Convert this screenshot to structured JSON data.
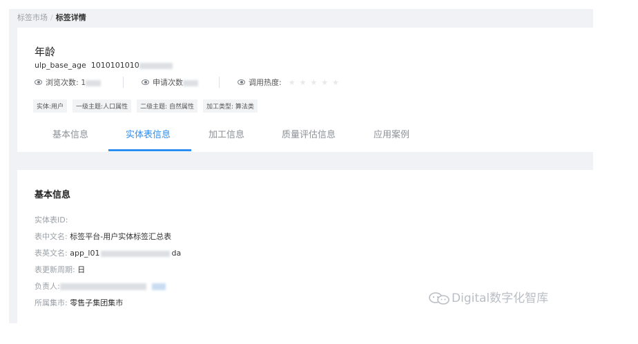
{
  "breadcrumb": {
    "parent": "标签市场",
    "current": "标签详情"
  },
  "tag": {
    "title": "年龄",
    "code": "ulp_base_age",
    "id_prefix": "1010101010"
  },
  "stats": {
    "views_label": "浏览次数:",
    "views_value_visible": "1",
    "applies_label": "申请次数",
    "heat_label": "调用热度:",
    "stars": "★★★★★"
  },
  "chips": [
    "实体:用户",
    "一级主题:人口属性",
    "二级主题: 自然属性",
    "加工类型: 算法类"
  ],
  "tabs": [
    "基本信息",
    "实体表信息",
    "加工信息",
    "质量评估信息",
    "应用案例"
  ],
  "active_tab": "实体表信息",
  "section": {
    "title": "基本信息",
    "fields": [
      {
        "label": "实体表ID:",
        "value": ""
      },
      {
        "label": "表中文名:",
        "value": "标签平台-用户实体标签汇总表"
      },
      {
        "label": "表英文名:",
        "value": "app_l01",
        "suffix": "da"
      },
      {
        "label": "表更新周期:",
        "value": "日"
      },
      {
        "label": "负责人:",
        "value": ""
      },
      {
        "label": "所属集市:",
        "value": "零售子集团集市"
      }
    ]
  },
  "watermark": "Digital数字化智库",
  "colors": {
    "accent": "#2b8ef0",
    "background": "#f0f2f5"
  }
}
